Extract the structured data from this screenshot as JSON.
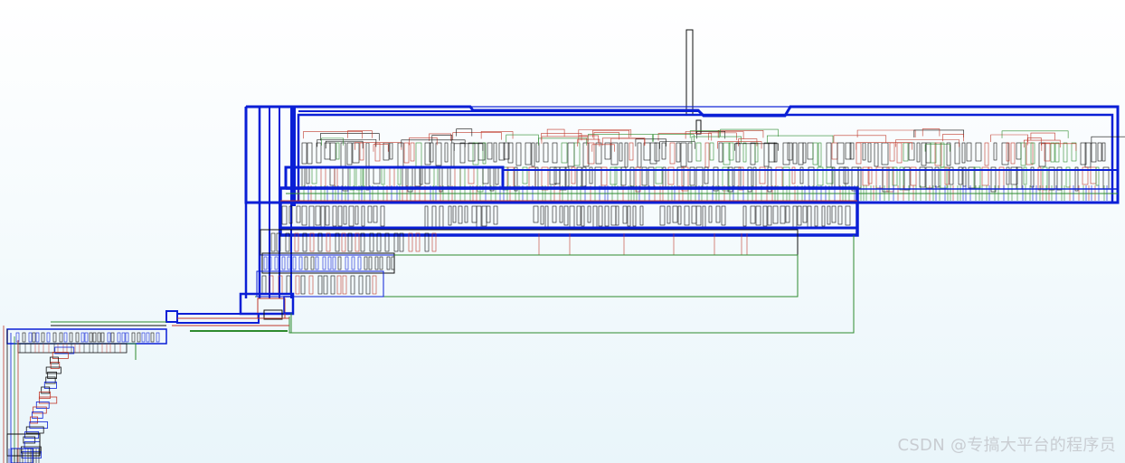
{
  "watermark": {
    "text": "CSDN @专搞大平台的程序员"
  },
  "colors": {
    "primary_edge": "#0a1fd6",
    "green_edge": "#2e8b2e",
    "red_edge": "#c0392b",
    "black_edge": "#111111",
    "background_top": "#ffffff",
    "background_bottom": "#e9f5fa"
  }
}
